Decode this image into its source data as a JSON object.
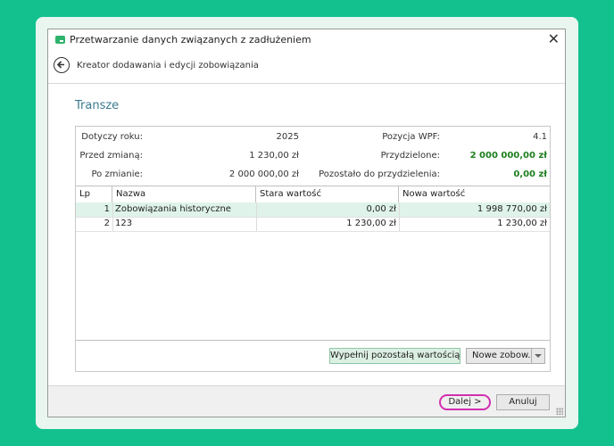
{
  "window": {
    "title": "Przetwarzanie danych związanych z zadłużeniem"
  },
  "header": {
    "subtitle": "Kreator dodawania i edycji zobowiązania"
  },
  "section": {
    "title": "Transze"
  },
  "info": {
    "year_label": "Dotyczy roku:",
    "year_value": "2025",
    "wpf_label": "Pozycja WPF:",
    "wpf_value": "4.1",
    "before_label": "Przed zmianą:",
    "before_value": "1 230,00 zł",
    "assigned_label": "Przydzielone:",
    "assigned_value": "2 000 000,00 zł",
    "after_label": "Po zmianie:",
    "after_value": "2 000 000,00 zł",
    "remaining_label": "Pozostało do przydzielenia:",
    "remaining_value": "0,00 zł"
  },
  "table": {
    "columns": [
      "Lp",
      "Nazwa",
      "Stara wartość",
      "Nowa wartość"
    ],
    "rows": [
      {
        "lp": "1",
        "name": "Zobowiązania historyczne",
        "old": "0,00 zł",
        "new": "1 998 770,00 zł"
      },
      {
        "lp": "2",
        "name": "123",
        "old": "1 230,00 zł",
        "new": "1 230,00 zł"
      }
    ]
  },
  "buttons": {
    "fill_remaining": "Wypełnij pozostałą wartością",
    "new_commitment": "Nowe zobow.",
    "next": "Dalej >",
    "cancel": "Anuluj"
  },
  "colors": {
    "background": "#13c18f",
    "accent_title": "#3a7a8f",
    "positive": "#1e7e1e",
    "highlight": "#d22fb0"
  }
}
